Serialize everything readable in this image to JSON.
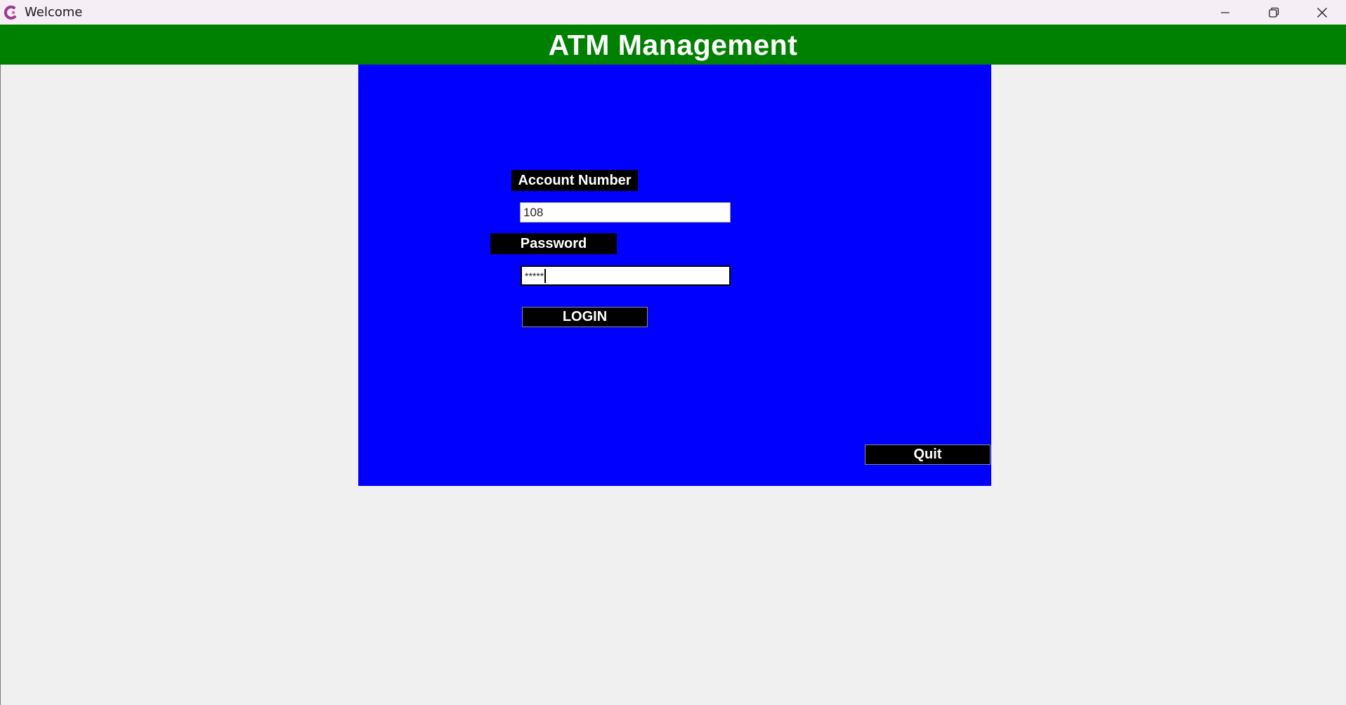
{
  "window": {
    "title": "Welcome",
    "icons": {
      "app": "app-logo-icon",
      "minimize": "minimize-icon",
      "restore": "restore-icon",
      "close": "close-icon"
    }
  },
  "banner": {
    "title": "ATM Management"
  },
  "login_form": {
    "account_label": "Account Number",
    "account_value": "108",
    "password_label": "Password",
    "password_value": "*****",
    "login_button": "LOGIN"
  },
  "quit_button": "Quit",
  "colors": {
    "banner": "#008000",
    "panel": "#0000ff",
    "label_bg": "#000000",
    "text": "#ffffff"
  }
}
